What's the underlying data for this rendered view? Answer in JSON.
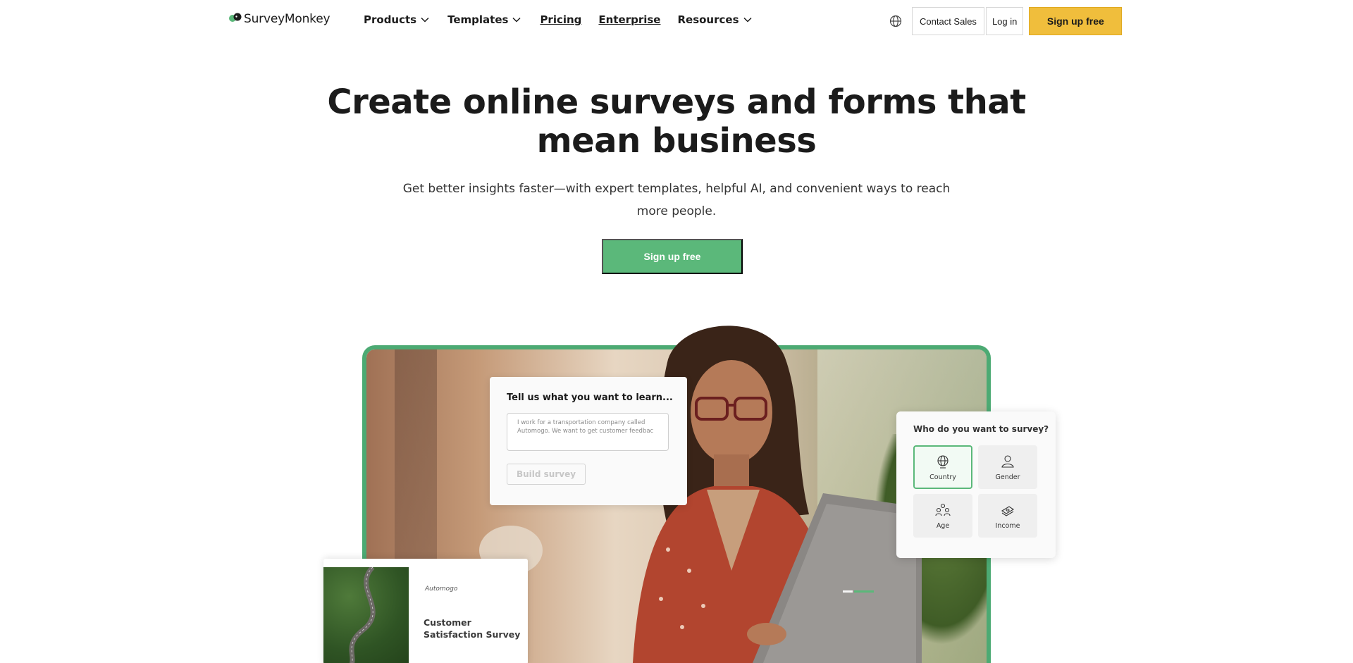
{
  "brand": {
    "name": "SurveyMonkey"
  },
  "nav": {
    "products": "Products",
    "templates": "Templates",
    "pricing": "Pricing",
    "enterprise": "Enterprise",
    "resources": "Resources"
  },
  "actions": {
    "contact_sales": "Contact Sales",
    "log_in": "Log in",
    "sign_up": "Sign up free"
  },
  "hero": {
    "title": "Create online surveys and forms that mean business",
    "subtitle": "Get better insights faster—with expert templates, helpful AI, and convenient ways to reach more people.",
    "cta": "Sign up free"
  },
  "learn_card": {
    "title": "Tell us what you want to learn...",
    "field_text": "I work for a transportation company called Automogo. We want to get customer feedbac",
    "build_button": "Build survey"
  },
  "who_card": {
    "title": "Who do you want to survey?",
    "options": [
      {
        "label": "Country",
        "icon": "globe-icon",
        "selected": true
      },
      {
        "label": "Gender",
        "icon": "person-icon",
        "selected": false
      },
      {
        "label": "Age",
        "icon": "people-icon",
        "selected": false
      },
      {
        "label": "Income",
        "icon": "money-icon",
        "selected": false
      }
    ]
  },
  "survey_card": {
    "brand": "Automogo",
    "title": "Customer Satisfaction Survey"
  },
  "colors": {
    "accent_yellow": "#f0be3c",
    "accent_green": "#5bb87a",
    "device_border": "#4caa73"
  }
}
